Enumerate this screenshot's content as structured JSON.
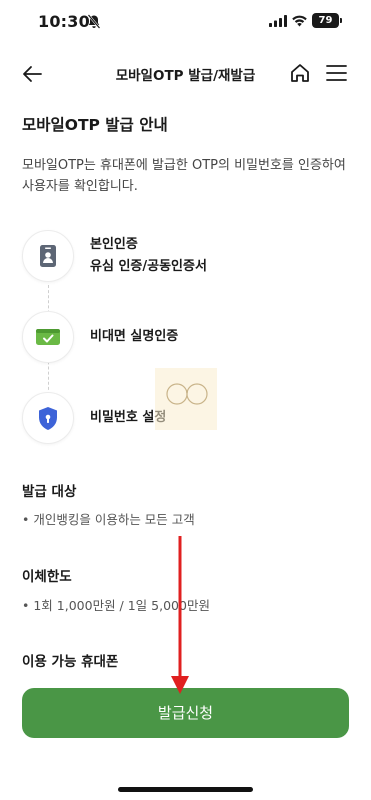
{
  "status_bar": {
    "time": "10:30",
    "battery": "79"
  },
  "header": {
    "title": "모바일OTP 발급/재발급"
  },
  "section": {
    "title": "모바일OTP 발급 안내",
    "description": "모바일OTP는 휴대폰에 발급한 OTP의 비밀번호를 인증하여 사용자를 확인합니다."
  },
  "steps": [
    {
      "line1": "본인인증",
      "line2": "유심 인증/공동인증서",
      "icon": "id-card-icon"
    },
    {
      "line1": "비대면 실명인증",
      "icon": "verified-card-icon"
    },
    {
      "line1": "비밀번호 설정",
      "icon": "shield-lock-icon"
    }
  ],
  "target": {
    "title": "발급 대상",
    "text": "개인뱅킹을 이용하는 모든 고객"
  },
  "limit": {
    "title": "이체한도",
    "text": "1회 1,000만원 / 1일 5,000만원"
  },
  "phones": {
    "title": "이용 가능 휴대폰"
  },
  "cta_label": "발급신청",
  "colors": {
    "accent": "#4a9646",
    "annotation": "#e02020"
  }
}
